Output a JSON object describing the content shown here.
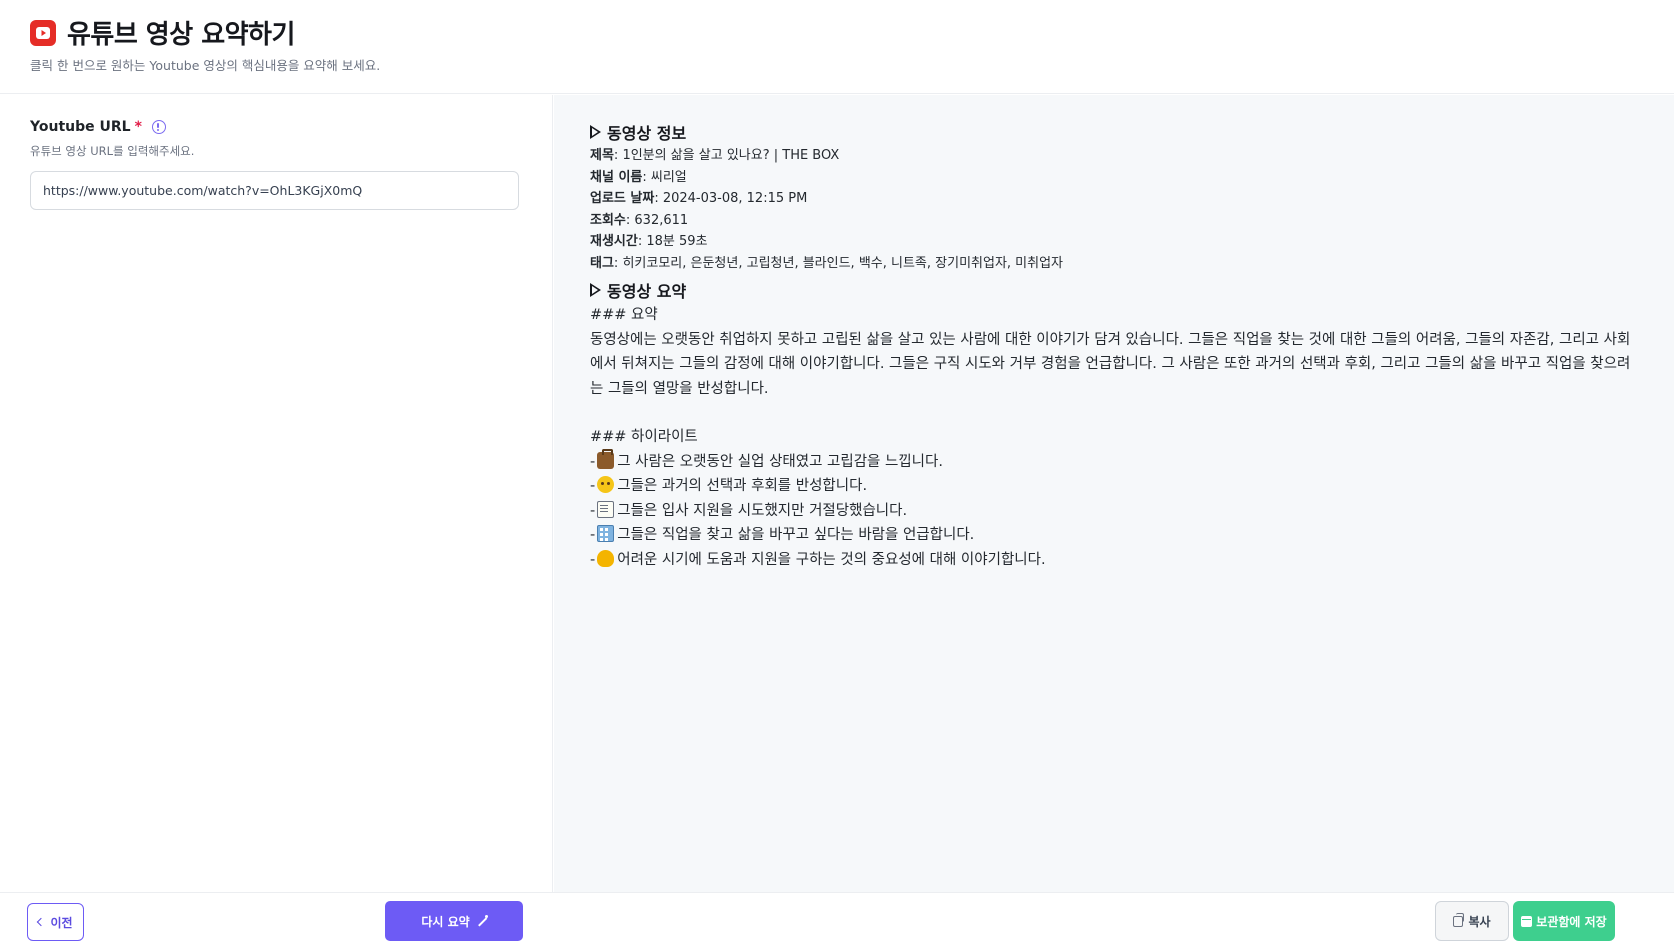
{
  "header": {
    "title": "유튜브 영상 요약하기",
    "subtitle": "클릭 한 번으로 원하는 Youtube 영상의 핵심내용을 요약해 보세요."
  },
  "form": {
    "url_label": "Youtube URL",
    "required_mark": "*",
    "url_help": "유튜브 영상 URL를 입력해주세요.",
    "url_value": "https://www.youtube.com/watch?v=OhL3KGjX0mQ"
  },
  "video_info": {
    "section_title": "동영상 정보",
    "fields": [
      {
        "label": "제목",
        "value": "1인분의 삶을 살고 있나요? | THE BOX"
      },
      {
        "label": "채널 이름",
        "value": "씨리얼"
      },
      {
        "label": "업로드 날짜",
        "value": "2024-03-08, 12:15 PM"
      },
      {
        "label": "조회수",
        "value": "632,611"
      },
      {
        "label": "재생시간",
        "value": "18분 59초"
      },
      {
        "label": "태그",
        "value": "히키코모리, 은둔청년, 고립청년, 블라인드, 백수, 니트족, 장기미취업자, 미취업자"
      }
    ]
  },
  "video_summary": {
    "section_title": "동영상 요약",
    "summary_heading": "### 요약",
    "summary_text": "동영상에는 오랫동안 취업하지 못하고 고립된 삶을 살고 있는 사람에 대한 이야기가 담겨 있습니다. 그들은 직업을 찾는 것에 대한 그들의 어려움, 그들의 자존감, 그리고 사회에서 뒤쳐지는 그들의 감정에 대해 이야기합니다. 그들은 구직 시도와 거부 경험을 언급합니다. 그 사람은 또한 과거의 선택과 후회, 그리고 그들의 삶을 바꾸고 직업을 찾으려는 그들의 열망을 반성합니다.",
    "highlights_heading": "### 하이라이트",
    "bullet": "-",
    "highlights": [
      {
        "icon": "briefcase-icon",
        "text": "그 사람은 오랫동안 실업 상태였고 고립감을 느낍니다."
      },
      {
        "icon": "thinking-face-icon",
        "text": "그들은 과거의 선택과 후회를 반성합니다."
      },
      {
        "icon": "memo-icon",
        "text": "그들은 입사 지원을 시도했지만 거절당했습니다."
      },
      {
        "icon": "office-building-icon",
        "text": "그들은 직업을 찾고 삶을 바꾸고 싶다는 바람을 언급합니다."
      },
      {
        "icon": "heart-icon",
        "text": "어려운 시기에 도움과 지원을 구하는 것의 중요성에 대해 이야기합니다."
      }
    ]
  },
  "footer": {
    "prev_label": "이전",
    "resummary_label": "다시 요약",
    "copy_label": "복사",
    "save_label": "보관함에 저장"
  },
  "colors": {
    "accent": "#6d5bf5",
    "youtube_red": "#e52d27",
    "save_green": "#3ecf8e",
    "required_red": "#e11d48",
    "right_pane_bg": "#f6f8fa"
  }
}
